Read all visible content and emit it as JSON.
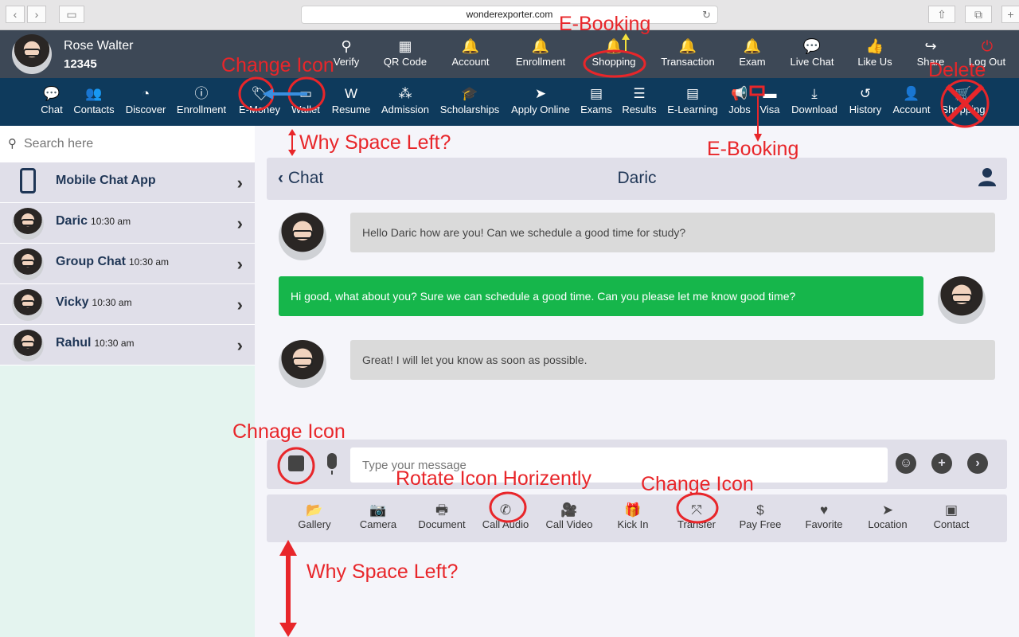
{
  "browser": {
    "url": "wonderexporter.com",
    "back": "‹",
    "forward": "›"
  },
  "user": {
    "name": "Rose Walter",
    "id": "12345"
  },
  "top_menu": [
    {
      "label": "Verify",
      "icon": "search-icon"
    },
    {
      "label": "QR Code",
      "icon": "qr-code-icon"
    },
    {
      "label": "Account",
      "icon": "bell-icon"
    },
    {
      "label": "Enrollment",
      "icon": "bell-icon"
    },
    {
      "label": "Shopping",
      "icon": "bell-icon"
    },
    {
      "label": "Transaction",
      "icon": "bell-icon"
    },
    {
      "label": "Exam",
      "icon": "bell-icon"
    },
    {
      "label": "Live Chat",
      "icon": "chat-bubble-icon"
    },
    {
      "label": "Like Us",
      "icon": "thumbs-up-icon"
    },
    {
      "label": "Share",
      "icon": "share-icon"
    },
    {
      "label": "Log Out",
      "icon": "power-icon"
    }
  ],
  "main_nav": [
    {
      "label": "Chat",
      "icon": "chat-icon"
    },
    {
      "label": "Contacts",
      "icon": "users-icon"
    },
    {
      "label": "Discover",
      "icon": "pie-chart-icon"
    },
    {
      "label": "Enrollment",
      "icon": "info-icon"
    },
    {
      "label": "E-Money",
      "icon": "tag-icon"
    },
    {
      "label": "Wallet",
      "icon": "money-bill-icon"
    },
    {
      "label": "Resume",
      "icon": "word-doc-icon"
    },
    {
      "label": "Admission",
      "icon": "cubes-icon"
    },
    {
      "label": "Scholarships",
      "icon": "graduation-cap-icon"
    },
    {
      "label": "Apply Online",
      "icon": "pointer-icon"
    },
    {
      "label": "Exams",
      "icon": "book-icon"
    },
    {
      "label": "Results",
      "icon": "list-icon"
    },
    {
      "label": "E-Learning",
      "icon": "book-icon"
    },
    {
      "label": "Jobs",
      "icon": "megaphone-icon"
    },
    {
      "label": "Visa",
      "icon": "credit-card-icon"
    },
    {
      "label": "Download",
      "icon": "download-icon"
    },
    {
      "label": "History",
      "icon": "history-icon"
    },
    {
      "label": "Account",
      "icon": "user-icon"
    },
    {
      "label": "Shopping",
      "icon": "shopping-icon"
    }
  ],
  "search": {
    "placeholder": "Search here"
  },
  "contacts": [
    {
      "name": "Mobile Chat App",
      "time": "",
      "icon": "mobile-phone-icon"
    },
    {
      "name": "Daric",
      "time": "10:30 am"
    },
    {
      "name": "Group Chat",
      "time": "10:30 am"
    },
    {
      "name": "Vicky",
      "time": "10:30 am"
    },
    {
      "name": "Rahul",
      "time": "10:30 am"
    }
  ],
  "chat": {
    "back_label": "Chat",
    "title": "Daric",
    "messages": [
      {
        "direction": "in",
        "text": "Hello Daric how are you! Can we schedule a good time for study?"
      },
      {
        "direction": "out",
        "text": "Hi good, what about you? Sure we can schedule a good time. Can you please let me know good time?"
      },
      {
        "direction": "in",
        "text": "Great! I will let you know as soon as possible."
      }
    ],
    "compose_placeholder": "Type your message"
  },
  "actions": [
    {
      "label": "Gallery",
      "icon": "folder-open-icon"
    },
    {
      "label": "Camera",
      "icon": "camera-icon"
    },
    {
      "label": "Document",
      "icon": "print-icon"
    },
    {
      "label": "Call Audio",
      "icon": "phone-icon"
    },
    {
      "label": "Call Video",
      "icon": "video-icon"
    },
    {
      "label": "Kick In",
      "icon": "gift-icon"
    },
    {
      "label": "Transfer",
      "icon": "expand-arrows-icon"
    },
    {
      "label": "Pay Free",
      "icon": "dollar-icon"
    },
    {
      "label": "Favorite",
      "icon": "heart-icon"
    },
    {
      "label": "Location",
      "icon": "location-arrow-icon"
    },
    {
      "label": "Contact",
      "icon": "address-card-icon"
    }
  ],
  "annotations": {
    "change_icon_top": "Change Icon",
    "e_booking_top": "E-Booking",
    "delete": "Delete",
    "why_space_top": "Why Space Left?",
    "e_booking_mid": "E-Booking",
    "chnage_icon": "Chnage Icon",
    "rotate_icon": "Rotate Icon Horizently",
    "change_icon_bottom": "Change Icon",
    "why_space_bottom": "Why Space Left?",
    "color": "#e8262a"
  }
}
